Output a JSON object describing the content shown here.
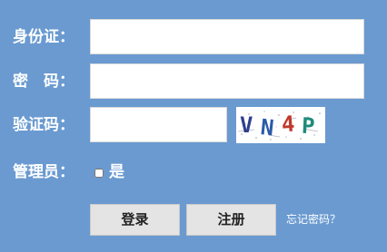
{
  "form": {
    "id_label": "身份证：",
    "password_label": "密　码：",
    "captcha_label": "验证码：",
    "admin_label": "管理员：",
    "id_value": "",
    "password_value": "",
    "captcha_value": ""
  },
  "captcha": {
    "chars": [
      {
        "char": "V",
        "color": "#2f3f8f"
      },
      {
        "char": "N",
        "color": "#2a5aa8"
      },
      {
        "char": "4",
        "color": "#c0392b"
      },
      {
        "char": "P",
        "color": "#1f8a7a"
      }
    ]
  },
  "admin_checkbox": {
    "label": "是",
    "checked": false
  },
  "buttons": {
    "login": "登录",
    "register": "注册"
  },
  "links": {
    "forgot_password": "忘记密码？"
  },
  "colors": {
    "background": "#6a9ad0",
    "button_bg": "#e4e4e4"
  }
}
